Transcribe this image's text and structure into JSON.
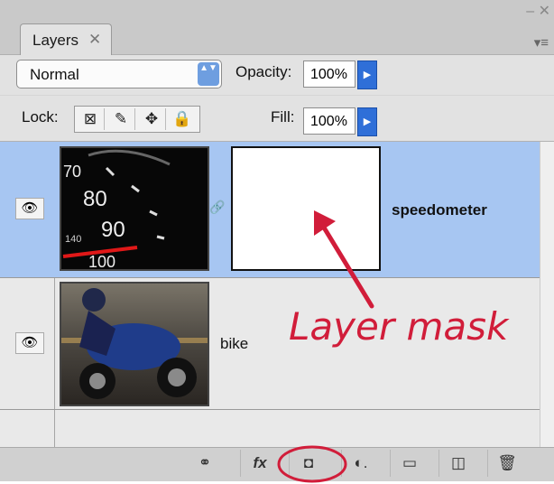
{
  "panel": {
    "tab_label": "Layers",
    "tab_close": "✕",
    "window_controls": "– ✕",
    "menu_glyph": "▾≡"
  },
  "blend": {
    "value": "Normal",
    "arrows": "▲▼"
  },
  "opacity": {
    "label": "Opacity:",
    "value": "100%",
    "arrow": "▶"
  },
  "lock": {
    "label": "Lock:"
  },
  "fill": {
    "label": "Fill:",
    "value": "100%",
    "arrow": "▶"
  },
  "layers": [
    {
      "name": "speedometer",
      "selected": true,
      "visible_icon": "eye-icon",
      "has_mask": true
    },
    {
      "name": "bike",
      "selected": false,
      "visible_icon": "eye-icon",
      "has_mask": false
    }
  ],
  "speedo": {
    "n70": "70",
    "n80": "80",
    "n90": "90",
    "n140": "140",
    "n100": "100"
  },
  "annotation": {
    "text": "Layer mask",
    "color": "#d11d3a"
  },
  "icons": {
    "eye": "👁",
    "link": "🔗",
    "lock_transparency": "⊠",
    "lock_paint": "✎",
    "lock_move": "✥",
    "lock_all": "🔒",
    "link_layers": "⚭",
    "fx": "fx",
    "add_mask": "◘",
    "adjustment": "◐.",
    "group": "▭",
    "new_layer": "◫",
    "delete": "🗑"
  },
  "colors": {
    "selected_row": "#a7c6f2",
    "accent_blue": "#2f6fd8",
    "annotation_red": "#d11d3a"
  }
}
